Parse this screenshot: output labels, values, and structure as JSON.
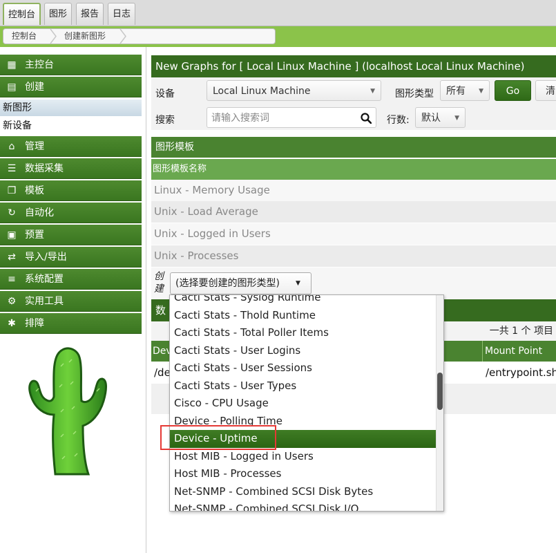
{
  "top_tabs": [
    "控制台",
    "图形",
    "报告",
    "日志"
  ],
  "breadcrumb": [
    "控制台",
    "创建新图形"
  ],
  "sidebar": {
    "items": [
      {
        "label": "主控台",
        "icon": "map-icon"
      },
      {
        "label": "创建",
        "icon": "chart-icon"
      },
      {
        "label": "管理",
        "icon": "home-icon"
      },
      {
        "label": "数据采集",
        "icon": "database-icon"
      },
      {
        "label": "模板",
        "icon": "copy-icon"
      },
      {
        "label": "自动化",
        "icon": "automation-icon"
      },
      {
        "label": "预置",
        "icon": "archive-icon"
      },
      {
        "label": "导入/导出",
        "icon": "exchange-icon"
      },
      {
        "label": "系统配置",
        "icon": "sliders-icon"
      },
      {
        "label": "实用工具",
        "icon": "gears-icon"
      },
      {
        "label": "排障",
        "icon": "bug-icon"
      }
    ],
    "subitems": [
      {
        "label": "新图形",
        "selected": true
      },
      {
        "label": "新设备",
        "selected": false
      }
    ]
  },
  "main": {
    "title": "New Graphs for [ Local Linux Machine ] (localhost Local Linux Machine)",
    "device_label": "设备",
    "device_value": "Local Linux Machine",
    "graph_type_label": "图形类型",
    "graph_type_value": "所有",
    "go_label": "Go",
    "clear_label": "清",
    "search_label": "搜索",
    "search_placeholder": "请输入搜索词",
    "rows_label": "行数:",
    "rows_value": "默认",
    "templates_header": "图形模板",
    "templates_col": "图形模板名称",
    "templates": [
      "Linux - Memory Usage",
      "Unix - Load Average",
      "Unix - Logged in Users",
      "Unix - Processes"
    ],
    "create_label": "创建",
    "create_select": "(选择要创建的图形类型)",
    "ds_header": "数",
    "ds_count": "一共 1 个 项目",
    "ds_col_left": "Dev",
    "ds_col_right": "Mount Point",
    "ds_row_left": "/de",
    "ds_row_right": "/entrypoint.sh"
  },
  "dropdown": {
    "options": [
      "Cacti Stats - Syslog Runtime",
      "Cacti Stats - Thold Runtime",
      "Cacti Stats - Total Poller Items",
      "Cacti Stats - User Logins",
      "Cacti Stats - User Sessions",
      "Cacti Stats - User Types",
      "Cisco - CPU Usage",
      "Device - Polling Time",
      "Device - Uptime",
      "Host MIB - Logged in Users",
      "Host MIB - Processes",
      "Net-SNMP - Combined SCSI Disk Bytes",
      "Net-SNMP - Combined SCSI Disk I/O"
    ],
    "highlighted": "Device - Uptime"
  },
  "colors": {
    "brand_green": "#366b1f",
    "nav_green": "#4e8a2f",
    "crumb_green": "#8bc34a",
    "highlight_border": "#e53935"
  }
}
